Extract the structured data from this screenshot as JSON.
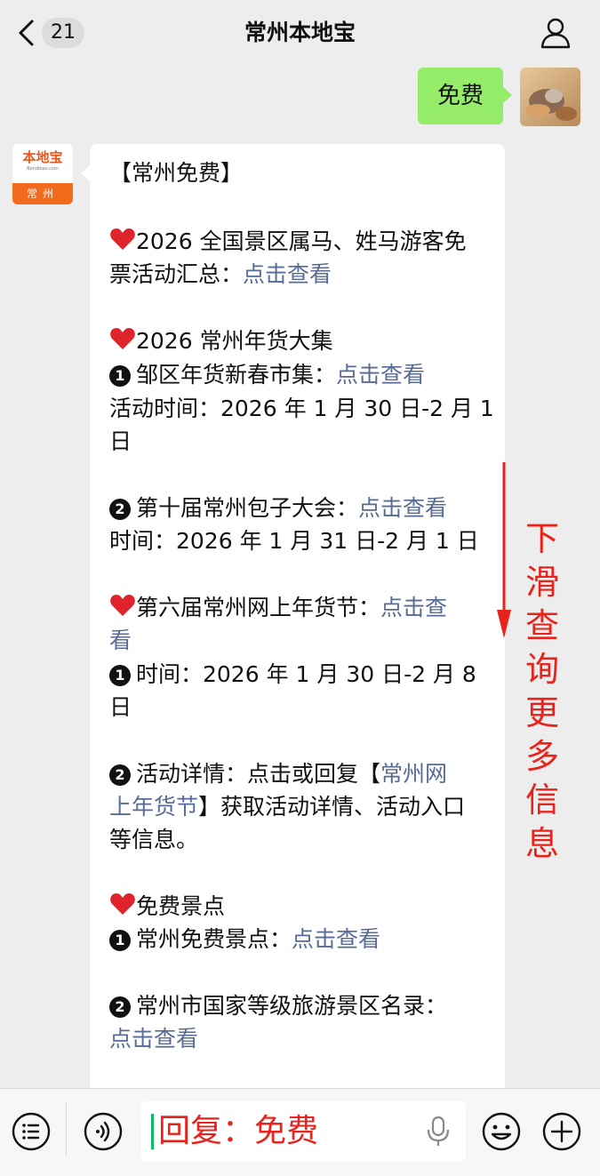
{
  "header": {
    "unread_count": "21",
    "title": "常州本地宝"
  },
  "sent_message": {
    "text": "免费"
  },
  "bot": {
    "avatar_logo_text": "本地宝",
    "avatar_logo_sub": "Bendibao.com",
    "avatar_city": "常州"
  },
  "message": {
    "heading": "【常州免费】",
    "s1_line1": "2026 全国景区属马、姓马游客免",
    "s1_line2_text": "票活动汇总：",
    "s1_link": "点击查看",
    "s2_title": "2026 常州年货大集",
    "s2_item1_num": "1",
    "s2_item1_text": "邹区年货新春市集：",
    "s2_item1_link": "点击查看",
    "s2_item1_time1": "活动时间：2026 年 1 月 30 日-2 月 1",
    "s2_item1_time2": "日",
    "s2_item2_num": "2",
    "s2_item2_text": "第十届常州包子大会：",
    "s2_item2_link": "点击查看",
    "s2_item2_time": "时间：2026 年 1 月 31 日-2 月 1 日",
    "s3_title": "第六届常州网上年货节：",
    "s3_link_a": "点击查",
    "s3_link_b": "看",
    "s3_item1_num": "1",
    "s3_item1_text1": "时间：2026 年 1 月 30 日-2 月 8",
    "s3_item1_text2": "日",
    "s3_item2_num": "2",
    "s3_item2_text": "活动详情：点击或回复【",
    "s3_item2_link_a": "常州网",
    "s3_item2_link_b": "上年货节",
    "s3_item2_text2": "】获取活动详情、活动入口",
    "s3_item2_text3": "等信息。",
    "s4_title": "免费景点",
    "s4_item1_num": "1",
    "s4_item1_text": "常州免费景点：",
    "s4_item1_link": "点击查看",
    "s4_item2_num": "2",
    "s4_item2_text": "常州市国家等级旅游景区名录：",
    "s4_item2_link": "点击查看"
  },
  "annotation": {
    "text": "下滑查询更多信息"
  },
  "input": {
    "text": "回复：免费"
  },
  "colors": {
    "link": "#576b95",
    "sent_bubble": "#95ec69",
    "annotation_red": "#e8231c",
    "brand_orange": "#f26a1b"
  },
  "icons": [
    "chevron-left-icon",
    "profile-icon",
    "heart-icon",
    "menu-list-icon",
    "voice-icon",
    "mic-icon",
    "emoji-icon",
    "plus-icon",
    "down-arrow-icon"
  ]
}
